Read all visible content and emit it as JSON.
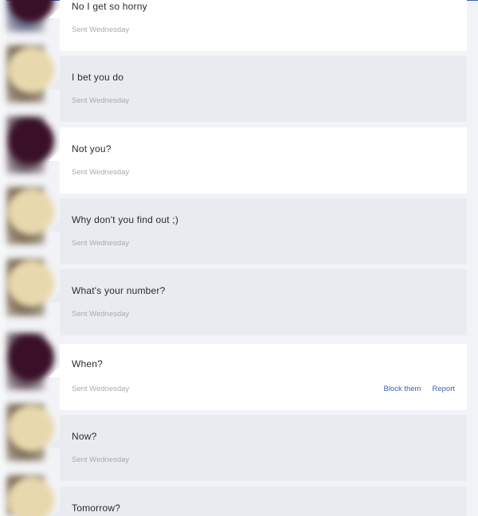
{
  "messages": [
    {
      "text": "No I get so horny",
      "time": "Sent Wednesday",
      "style": "white",
      "avatar": "blue"
    },
    {
      "text": "I bet you do",
      "time": "Sent Wednesday",
      "style": "grey",
      "avatar": "warm"
    },
    {
      "text": "Not you?",
      "time": "Sent Wednesday",
      "style": "white",
      "avatar": "dark"
    },
    {
      "text": "Why don't you find out ;)",
      "time": "Sent Wednesday",
      "style": "grey",
      "avatar": "warm"
    },
    {
      "text": "What's your number?",
      "time": "Sent Wednesday",
      "style": "grey",
      "avatar": "warm"
    },
    {
      "text": "When?",
      "time": "Sent Wednesday",
      "style": "white",
      "avatar": "dark",
      "actions": {
        "block": "Block them",
        "report": "Report"
      }
    },
    {
      "text": "Now?",
      "time": "Sent Wednesday",
      "style": "grey",
      "avatar": "warm"
    },
    {
      "text": "Tomorrow?",
      "time": "",
      "style": "grey",
      "avatar": "warm"
    }
  ],
  "colors": {
    "accent": "#3b63b8",
    "bubble_white": "#ffffff",
    "bubble_grey": "#e9ebf0"
  }
}
